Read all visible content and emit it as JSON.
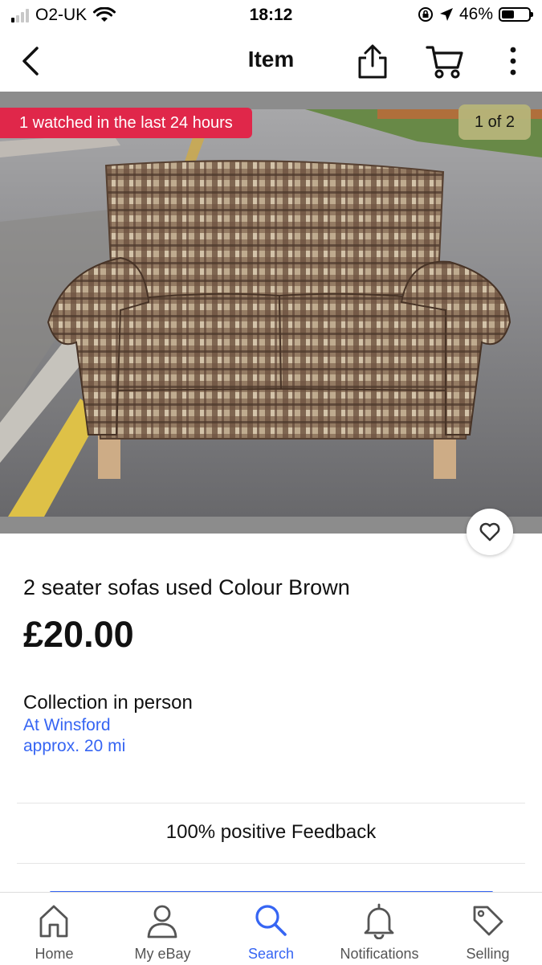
{
  "status_bar": {
    "carrier": "O2-UK",
    "time": "18:12",
    "battery": "46%",
    "battery_level": 0.46,
    "signal_bars_active": 1,
    "signal_bars_total": 4
  },
  "nav": {
    "title": "Item",
    "icons": [
      "chevron-left-icon",
      "share-icon",
      "cart-icon",
      "more-vertical-icon"
    ]
  },
  "gallery": {
    "watched_text": "1 watched in the last 24 hours",
    "counter": "1 of 2",
    "image_subject": "photo of a 2 seater brown checked fabric sofa on a street"
  },
  "item": {
    "title": "2 seater sofas used Colour Brown",
    "price": "£20.00",
    "collection_label": "Collection in person",
    "collection_location": "At Winsford",
    "collection_distance": "approx. 20 mi",
    "feedback": "100% positive Feedback"
  },
  "tabs": [
    {
      "label": "Home",
      "icon": "home-icon",
      "active": false
    },
    {
      "label": "My eBay",
      "icon": "person-icon",
      "active": false
    },
    {
      "label": "Search",
      "icon": "search-icon",
      "active": true
    },
    {
      "label": "Notifications",
      "icon": "bell-icon",
      "active": false
    },
    {
      "label": "Selling",
      "icon": "tag-icon",
      "active": false
    }
  ],
  "colors": {
    "accent_blue": "#3665f3",
    "watched_badge_red": "#e0274a",
    "counter_badge": "#b7b57a",
    "gallery_frame": "#8c8c8c"
  }
}
